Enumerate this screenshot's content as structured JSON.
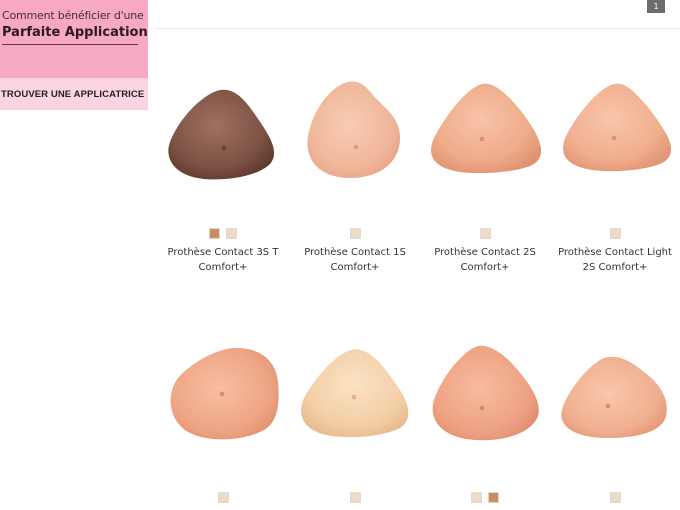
{
  "promo": {
    "line1": "Comment bénéficier d'une",
    "line2": "Parfaite Application",
    "cta": "TROUVER UNE APPLICATRICE"
  },
  "pagination": {
    "current": "1"
  },
  "colors": {
    "promo_pink": "#f7a8c4",
    "promo_light_pink": "#fbd4e2",
    "swatch_light": "#eadcc9",
    "swatch_tan": "#c98c66",
    "swatch_brown": "#8b5a43"
  },
  "products": [
    {
      "name_line1": "Prothèse Contact 3S T",
      "name_line2": "Comfort+",
      "swatches": [
        "#c98c66",
        "#eadcc9"
      ]
    },
    {
      "name_line1": "Prothèse Contact 1S",
      "name_line2": "Comfort+",
      "swatches": [
        "#eadcc9"
      ]
    },
    {
      "name_line1": "Prothèse Contact 2S",
      "name_line2": "Comfort+",
      "swatches": [
        "#eadcc9"
      ]
    },
    {
      "name_line1": "Prothèse Contact Light",
      "name_line2": "2S Comfort+",
      "swatches": [
        "#eadcc9"
      ]
    },
    {
      "name_line1": "",
      "name_line2": "",
      "swatches": [
        "#eadcc9"
      ]
    },
    {
      "name_line1": "",
      "name_line2": "",
      "swatches": [
        "#eadcc9"
      ]
    },
    {
      "name_line1": "",
      "name_line2": "",
      "swatches": [
        "#eadcc9",
        "#c98c66"
      ]
    },
    {
      "name_line1": "",
      "name_line2": "",
      "swatches": [
        "#eadcc9"
      ]
    }
  ]
}
